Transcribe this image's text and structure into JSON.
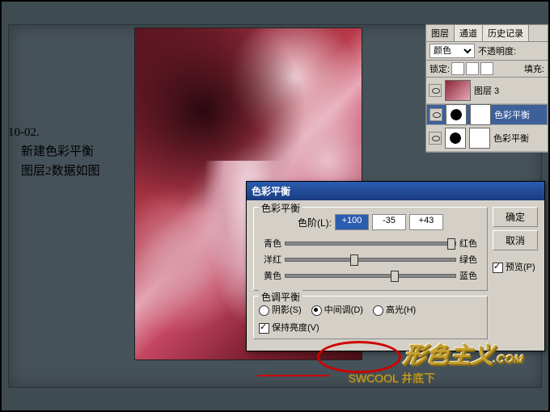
{
  "caption": {
    "line1": "10-02.",
    "line2": "新建色彩平衡",
    "line3": "图层2数据如图"
  },
  "panels": {
    "tabs": [
      "图层",
      "通道",
      "历史记录"
    ],
    "blend_label": "颜色",
    "opacity_label": "不透明度:",
    "lock_label": "锁定:",
    "fill_label": "填充:",
    "layers": [
      {
        "name": "图层 3",
        "type": "raster"
      },
      {
        "name": "色彩平衡",
        "type": "adj",
        "selected": true
      },
      {
        "name": "色彩平衡",
        "type": "adj"
      }
    ]
  },
  "dialog": {
    "title": "色彩平衡",
    "ok": "确定",
    "cancel": "取消",
    "preview": "预览(P)",
    "group1": {
      "label": "色彩平衡",
      "levels_label": "色阶(L):",
      "values": [
        "+100",
        "-35",
        "+43"
      ],
      "sliders": [
        {
          "left": "青色",
          "right": "红色",
          "pos": 95
        },
        {
          "left": "洋红",
          "right": "绿色",
          "pos": 38
        },
        {
          "left": "黄色",
          "right": "蓝色",
          "pos": 62
        }
      ]
    },
    "group2": {
      "label": "色调平衡",
      "shadows": "阴影(S)",
      "midtones": "中间调(D)",
      "highlights": "高光(H)",
      "preserve": "保持亮度(V)"
    }
  },
  "watermark": {
    "brand": "形色主义",
    "url": "SWCOOL",
    "sub": "井底下",
    "com": ".COM"
  }
}
